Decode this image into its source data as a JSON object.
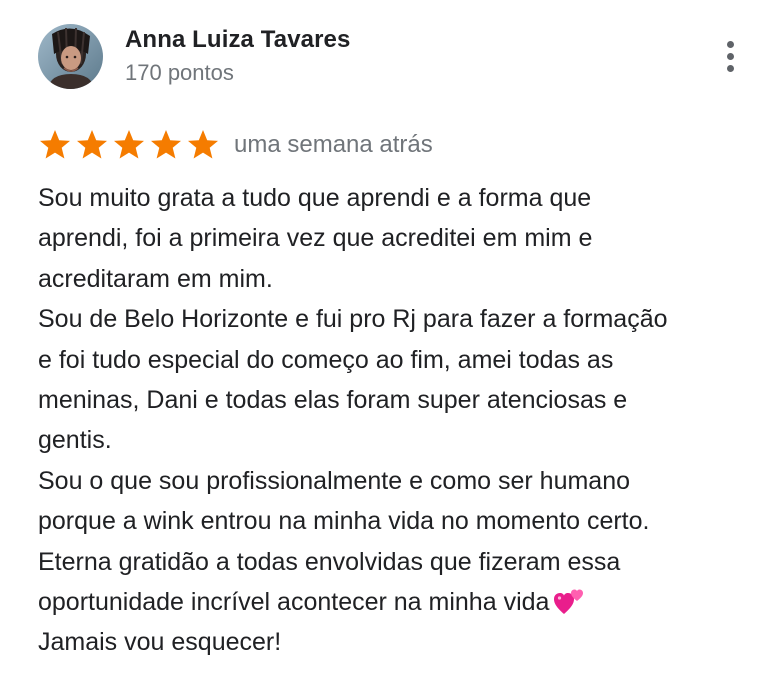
{
  "reviewer": {
    "name": "Anna Luiza Tavares",
    "points": "170 pontos",
    "avatar_icon": "profile-photo"
  },
  "menu": {
    "icon": "more-vert-icon"
  },
  "rating": {
    "stars": 5,
    "max": 5,
    "star_color": "#f57c00",
    "date": "uma semana atrás"
  },
  "review": {
    "lines": [
      "Sou muito grata a tudo que aprendi e a forma que",
      "aprendi, foi a primeira vez que acreditei em mim e",
      "acreditaram em mim.",
      "Sou de Belo Horizonte e fui pro Rj para fazer a formação",
      "e foi tudo especial do começo ao fim, amei todas as",
      "meninas, Dani e todas elas foram super atenciosas e",
      "gentis.",
      "Sou o que sou profissionalmente e como ser humano",
      "porque a wink entrou na minha vida no momento certo.",
      "Eterna gratidão a todas envolvidas que fizeram essa",
      "oportunidade incrível acontecer na minha vida",
      "Jamais vou esquecer!"
    ],
    "emoji_icon": "two-hearts-icon"
  },
  "colors": {
    "text": "#202124",
    "secondary_text": "#70757a",
    "star": "#f57c00",
    "heart": "#e91e8c"
  }
}
